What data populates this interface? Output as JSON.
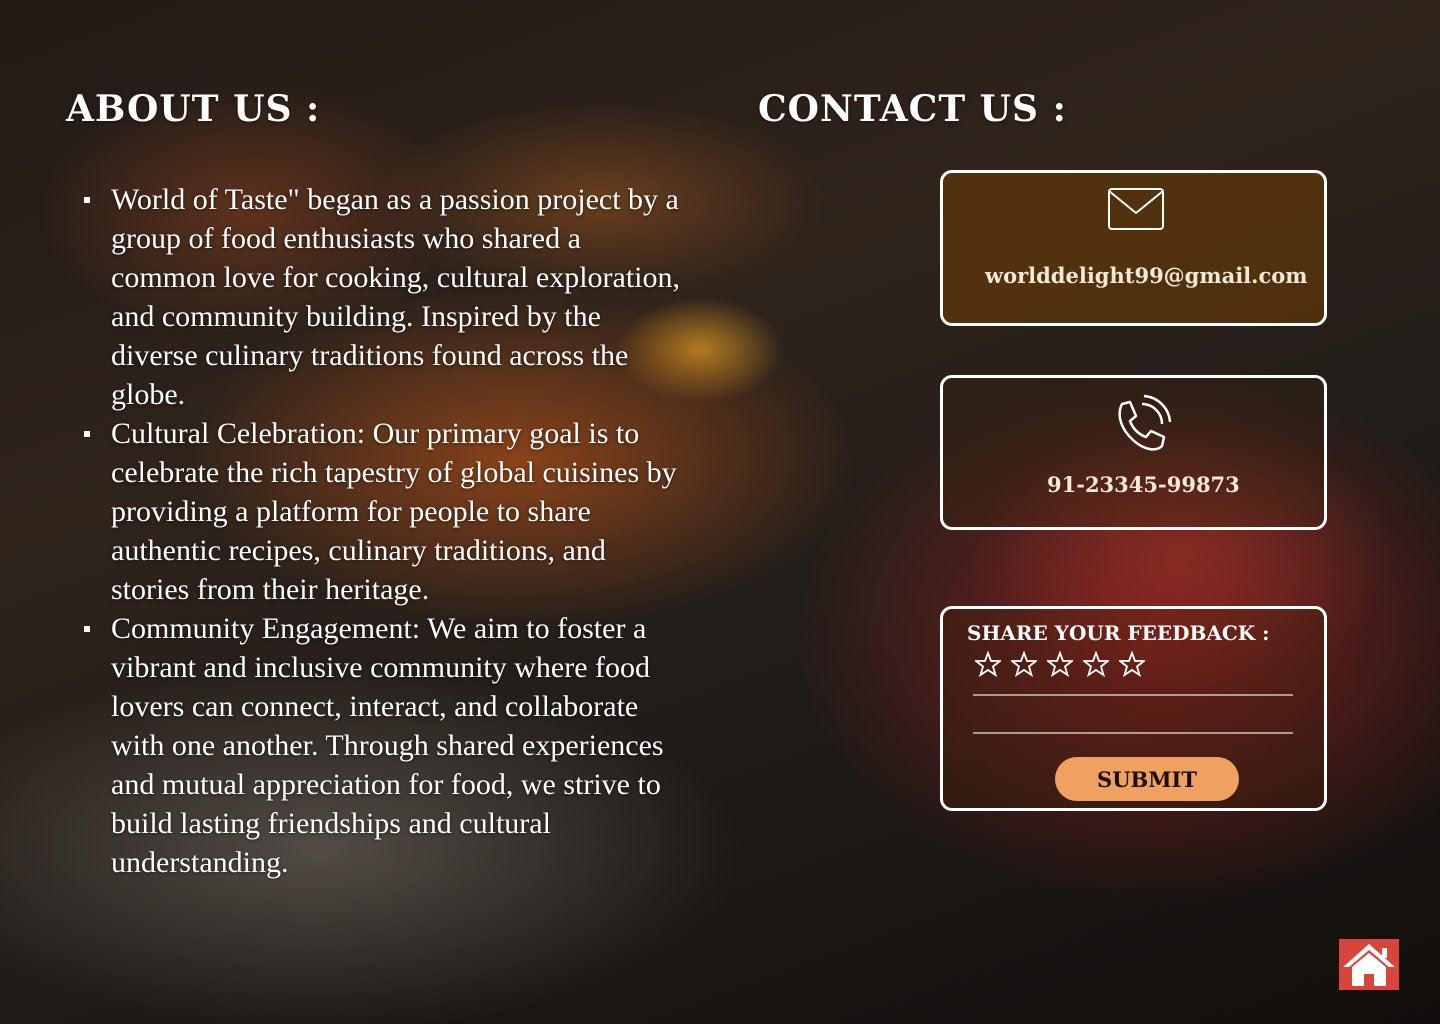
{
  "about": {
    "heading": "ABOUT US :",
    "items": [
      "World of Taste\" began as a passion project by a group of food enthusiasts who shared a common love for cooking, cultural exploration, and community building. Inspired by the diverse culinary traditions found across the globe.",
      "Cultural Celebration: Our primary goal is to celebrate the rich tapestry of global cuisines by providing a platform for people to share authentic recipes, culinary traditions, and stories from their heritage.",
      "Community Engagement: We aim to foster a vibrant and inclusive community where food lovers can connect, interact, and collaborate with one another. Through shared experiences and mutual appreciation for food, we strive to build lasting friendships and cultural understanding."
    ]
  },
  "contact": {
    "heading": "CONTACT  US :",
    "email": "worlddelight99@gmail.com",
    "phone": "91-23345-99873",
    "email_icon": "envelope-icon",
    "phone_icon": "phone-icon"
  },
  "feedback": {
    "title": "SHARE YOUR FEEDBACK :",
    "rating_max": 5,
    "rating_value": 0,
    "submit_label": "SUBMIT"
  },
  "nav": {
    "home_icon": "home-icon"
  },
  "colors": {
    "submit_bg": "#f0a060",
    "home_bg": "#d9453a",
    "email_card_bg": "#5f370a"
  }
}
